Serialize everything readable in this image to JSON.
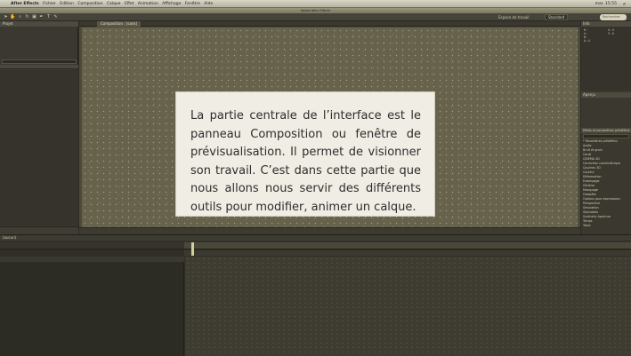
{
  "menubar": {
    "apple": "",
    "items": [
      "After Effects",
      "Fichier",
      "Edition",
      "Composition",
      "Calque",
      "Effet",
      "Animation",
      "Affichage",
      "Fenêtre",
      "Aide"
    ],
    "clock": "mar. 15:55"
  },
  "titlebar": {
    "title": "Adobe After Effects"
  },
  "toolbar": {
    "workspace_label": "Espace de travail",
    "workspace_value": "Standard",
    "search_placeholder": "Rechercher dans l'aide"
  },
  "project_panel": {
    "tab": "Projet"
  },
  "composition_panel": {
    "tab": "Composition : (sans)"
  },
  "info_panel": {
    "tab": "Info",
    "values": [
      "R :",
      "V :",
      "B :",
      "A : 0",
      "X : 0",
      "Y : 0"
    ]
  },
  "preview_panel": {
    "tab": "Aperçu"
  },
  "effects_panel": {
    "tab": "Effets et paramètres prédéfinis",
    "items": [
      "* Paramètres prédéfinis",
      "Audio",
      "Bruit et grain",
      "Canal",
      "CINEMA 4D",
      "Correction colorimétrique",
      "Couches 3D",
      "Couleur",
      "Déformation",
      "Estompage",
      "Générer",
      "Masquage",
      "Obsolète",
      "Options pour expressions",
      "Perspective",
      "Simulation",
      "Stylisation",
      "Synthetic Aperture",
      "Temps",
      "Texte"
    ]
  },
  "timeline_panel": {
    "tab": "(aucun)"
  },
  "annotation": {
    "text": "La partie centrale de l’interface est le panneau Composition ou fenêtre de prévisualisation. Il permet de visionner son travail. C’est dans cette partie que nous allons nous servir des différents outils pour modifier, animer un calque."
  },
  "colors": {
    "composition_bg": "#67624c",
    "card_bg": "#f0ede4",
    "card_text": "#2d2d2d"
  },
  "icons": [
    "apple-icon",
    "spotlight-icon",
    "selection-tool-icon",
    "hand-tool-icon",
    "zoom-tool-icon",
    "rotate-tool-icon",
    "camera-tool-icon",
    "pen-tool-icon",
    "text-tool-icon",
    "brush-tool-icon"
  ]
}
